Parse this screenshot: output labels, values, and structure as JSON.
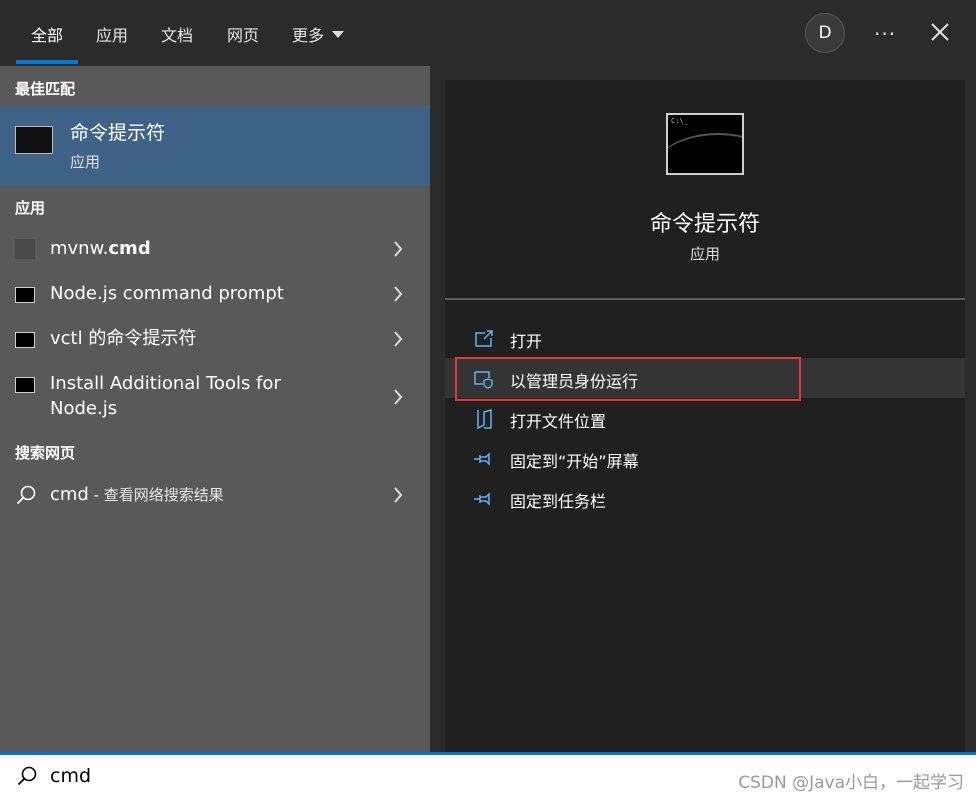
{
  "tabs": [
    {
      "label": "全部"
    },
    {
      "label": "应用"
    },
    {
      "label": "文档"
    },
    {
      "label": "网页"
    },
    {
      "label": "更多"
    }
  ],
  "account": {
    "initial": "D"
  },
  "more_glyph": "···",
  "sections": {
    "best_match": "最佳匹配",
    "apps": "应用",
    "web": "搜索网页"
  },
  "best_match": {
    "title": "命令提示符",
    "subtitle": "应用"
  },
  "apps": [
    {
      "name_plain": "mvnw.",
      "name_bold": "cmd"
    },
    {
      "name_plain": "Node.js command prompt",
      "name_bold": ""
    },
    {
      "name_plain": "vctl 的命令提示符",
      "name_bold": ""
    },
    {
      "name_plain": "Install Additional Tools for",
      "name_line2": "Node.js",
      "name_bold": ""
    }
  ],
  "web_result": {
    "query": "cmd",
    "suffix": " - 查看网络搜索结果"
  },
  "detail": {
    "icon_label": "C:\\_",
    "title": "命令提示符",
    "subtitle": "应用",
    "actions": [
      {
        "label": "打开",
        "icon": "open-icon"
      },
      {
        "label": "以管理员身份运行",
        "icon": "shield-icon"
      },
      {
        "label": "打开文件位置",
        "icon": "folder-icon"
      },
      {
        "label": "固定到“开始”屏幕",
        "icon": "pin-icon"
      },
      {
        "label": "固定到任务栏",
        "icon": "pin-icon"
      }
    ]
  },
  "search": {
    "value": "cmd"
  },
  "watermark": "CSDN @Java小白，一起学习",
  "colors": {
    "accent": "#0078d7",
    "selected": "#3f6386",
    "highlight": "#e53935",
    "icon_blue": "#5fb2f2"
  }
}
